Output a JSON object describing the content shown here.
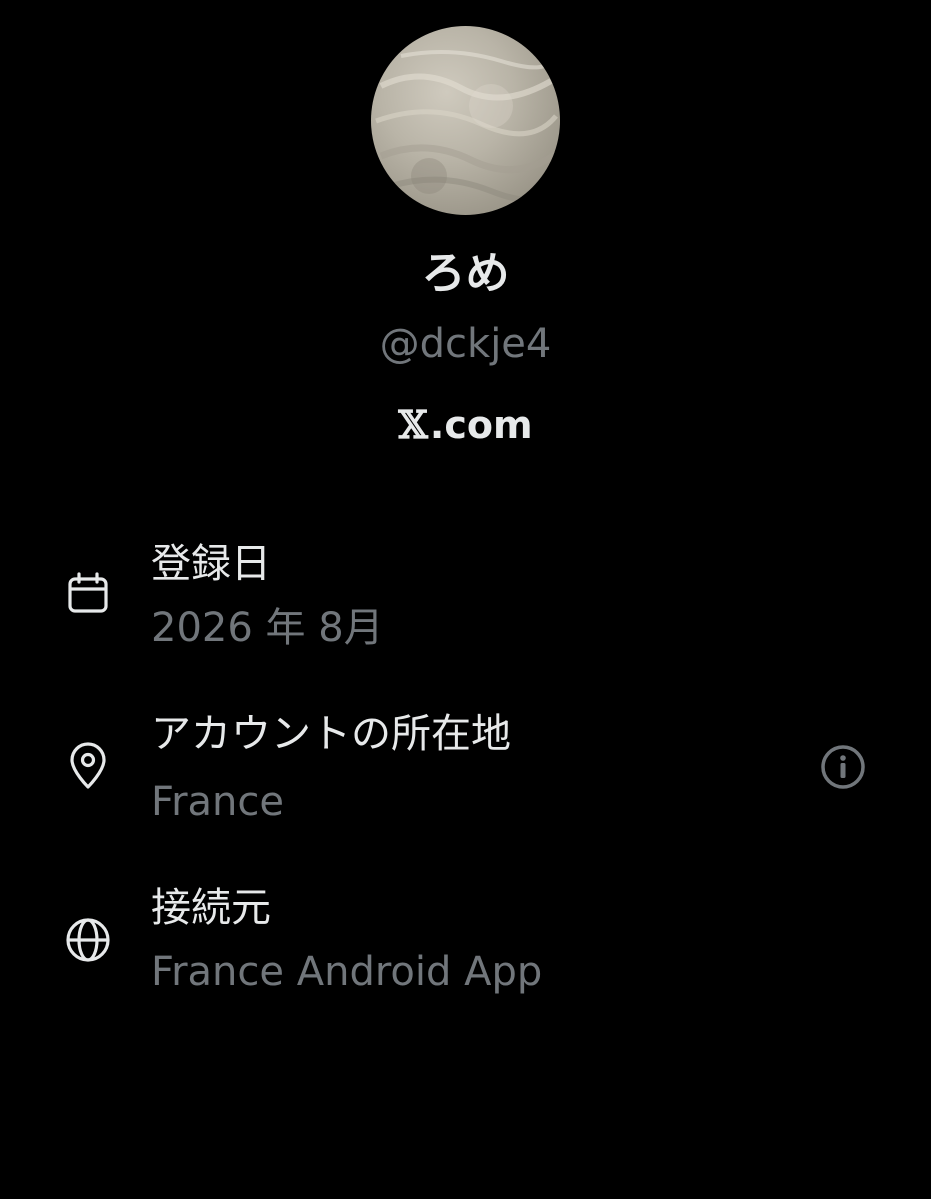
{
  "profile": {
    "display_name": "ろめ",
    "handle": "@dckje4",
    "site_mark": "𝕏",
    "site_suffix": ".com"
  },
  "details": [
    {
      "icon": "calendar-icon",
      "label": "登録日",
      "value": "2026 年 8月"
    },
    {
      "icon": "location-pin-icon",
      "label": "アカウントの所在地",
      "value": "France"
    },
    {
      "icon": "globe-icon",
      "label": "接続元",
      "value": "France Android App"
    }
  ],
  "colors": {
    "background": "#000000",
    "primary_text": "#e7e9ea",
    "secondary_text": "#71767b"
  }
}
